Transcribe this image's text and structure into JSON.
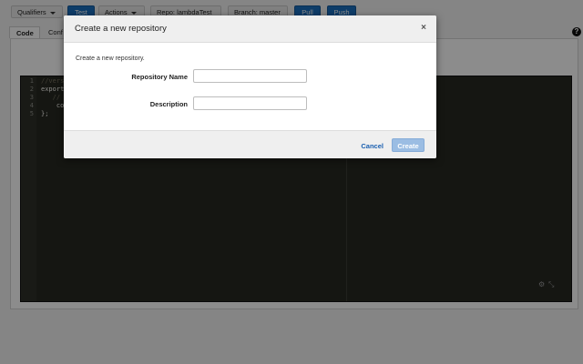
{
  "toolbar": {
    "qualifiers_label": "Qualifiers",
    "test_label": "Test",
    "actions_label": "Actions",
    "repo_label": "Repo: lambdaTest",
    "branch_label": "Branch: master",
    "pull_label": "Pull",
    "push_label": "Push"
  },
  "tabs": {
    "code_label": "Code",
    "config_label": "Conf"
  },
  "help_icon_glyph": "?",
  "editor": {
    "line_numbers": [
      "1",
      "2",
      "3",
      "4",
      "5"
    ],
    "lines": [
      "//vers",
      "export",
      "   //",
      "    co",
      "};"
    ]
  },
  "modal": {
    "title": "Create a new repository",
    "close_glyph": "×",
    "description": "Create a new repository.",
    "repo_name_label": "Repository Name",
    "repo_name_value": "",
    "description_label": "Description",
    "description_value": "",
    "cancel_label": "Cancel",
    "create_label": "Create"
  },
  "colors": {
    "primary_blue": "#1a6fc0",
    "disabled_blue": "#9bbde3",
    "editor_bg": "#272822",
    "overlay": "rgba(0,0,0,0.45)"
  }
}
